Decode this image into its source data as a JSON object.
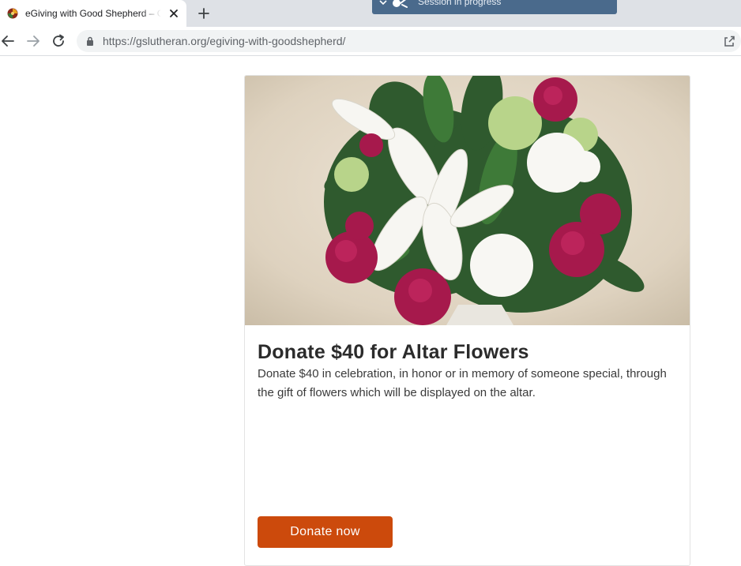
{
  "browser": {
    "tab_title": "eGiving with Good Shepherd – Good Shepherd Lutheran",
    "session_banner": "Session in progress",
    "url_host": "https://gslutheran.org",
    "url_path": "/egiving-with-goodshepherd/"
  },
  "card": {
    "image_alt": "altar flowers",
    "title": "Donate $40 for Altar Flowers",
    "description": "Donate $40 in celebration, in honor or in memory of someone special, through the gift of flowers which will be displayed on the altar.",
    "button_label": "Donate now"
  },
  "colors": {
    "button": "#cc4a0c",
    "session_banner": "#4a6a8c"
  },
  "icons": [
    "favicon-icon",
    "close-icon",
    "plus-icon",
    "chevron-down-icon",
    "remote-session-icon",
    "back-arrow-icon",
    "forward-arrow-icon",
    "reload-icon",
    "lock-icon",
    "share-icon"
  ]
}
